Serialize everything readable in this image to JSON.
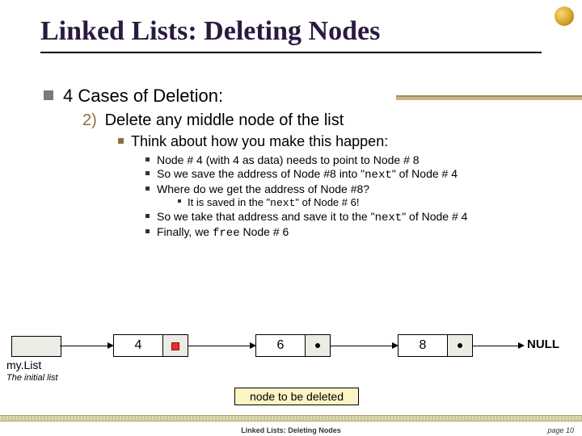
{
  "title": "Linked Lists:  Deleting Nodes",
  "cases_heading": "4 Cases of Deletion:",
  "case2_num": "2)",
  "case2_text": "Delete any middle node of the list",
  "think": "Think about how you make this happen:",
  "pt1_a": "Node # 4 (with 4 as data) needs to point to Node # 8",
  "pt2_a": "So we save the address of Node #8 into \"",
  "pt2_b": "\" of Node # 4",
  "pt3_a": "Where do we get the address of Node #8?",
  "pt3s_a": "It is saved in the \"",
  "pt3s_b": "\" of Node # 6!",
  "pt4_a": "So we take that address and save it to the \"",
  "pt4_b": "\" of Node # 4",
  "pt5_a": "Finally, we ",
  "pt5_b": " Node # 6",
  "code_next": "next",
  "code_free": "free",
  "diagram": {
    "mylist": "my.List",
    "initial": "The initial list",
    "n1": "4",
    "n2": "6",
    "n3": "8",
    "null": "NULL",
    "delete_label": "node to be deleted"
  },
  "footer": {
    "title": "Linked Lists: Deleting Nodes",
    "page": "page 10"
  }
}
